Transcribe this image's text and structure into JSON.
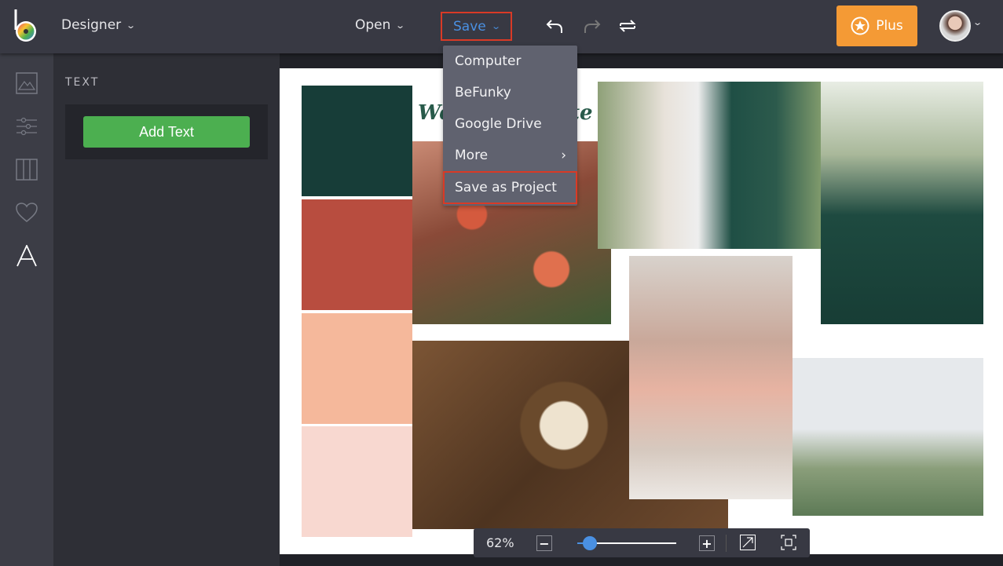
{
  "header": {
    "mode_label": "Designer",
    "open_label": "Open",
    "save_label": "Save",
    "plus_label": "Plus",
    "accent_color": "#4a90e2",
    "highlight_color": "#d93a26"
  },
  "save_menu": {
    "items": [
      {
        "label": "Computer"
      },
      {
        "label": "BeFunky"
      },
      {
        "label": "Google Drive"
      },
      {
        "label": "More",
        "submenu": true
      },
      {
        "label": "Save as Project",
        "highlighted": true
      }
    ]
  },
  "sidebar": {
    "icons": [
      "image-icon",
      "sliders-icon",
      "layout-icon",
      "heart-icon",
      "text-icon"
    ],
    "active": "text-icon"
  },
  "panel": {
    "title": "TEXT",
    "add_text_label": "Add Text"
  },
  "canvas": {
    "title_fragment_left": "We",
    "title_fragment_right": "te",
    "swatches": [
      "#173d38",
      "#b84d3f",
      "#f5b89b",
      "#f8d8d0"
    ]
  },
  "zoom": {
    "level_label": "62%",
    "level_fraction": 0.1
  }
}
